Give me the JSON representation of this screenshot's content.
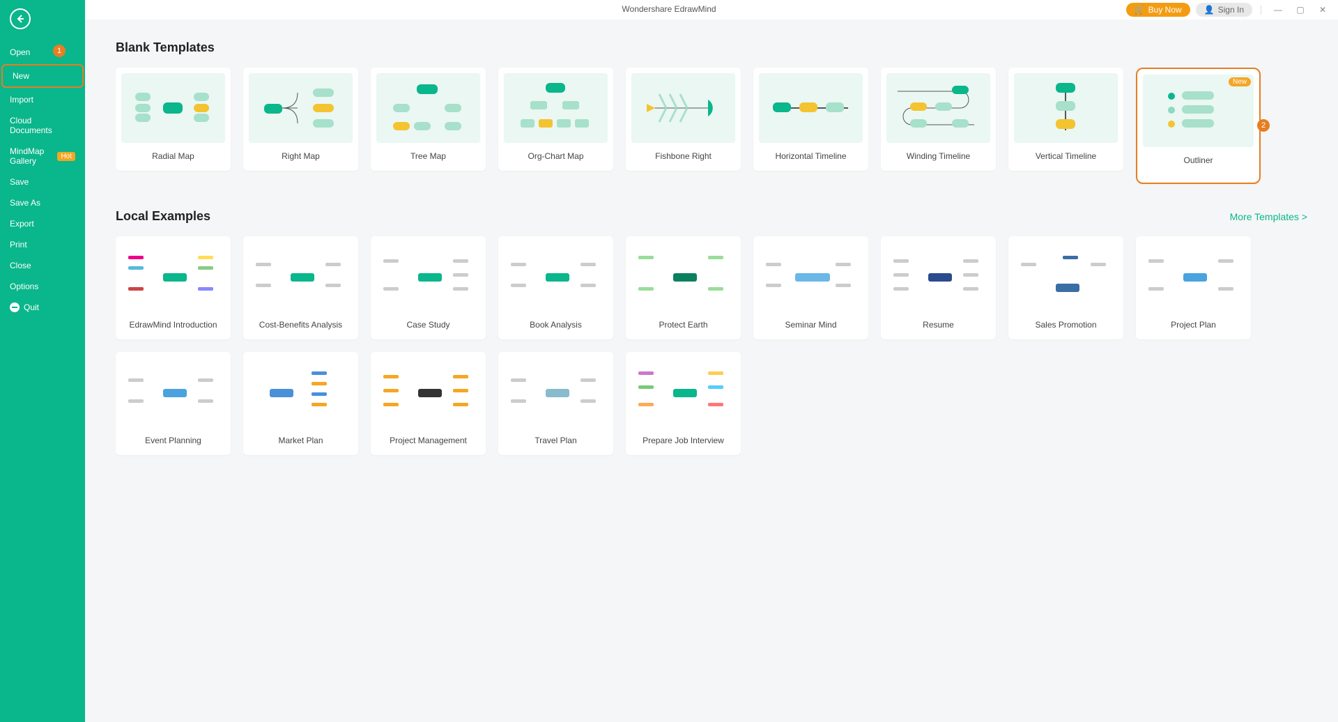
{
  "titlebar": {
    "app_title": "Wondershare EdrawMind",
    "buy_now_label": "Buy Now",
    "sign_in_label": "Sign In"
  },
  "sidebar": {
    "items": [
      {
        "label": "Open"
      },
      {
        "label": "New",
        "selected": true
      },
      {
        "label": "Import"
      },
      {
        "label": "Cloud Documents"
      },
      {
        "label": "MindMap Gallery",
        "hot": true
      },
      {
        "label": "Save"
      },
      {
        "label": "Save As"
      },
      {
        "label": "Export"
      },
      {
        "label": "Print"
      },
      {
        "label": "Close"
      },
      {
        "label": "Options"
      },
      {
        "label": "Quit",
        "quit_icon": true
      }
    ]
  },
  "step_markers": {
    "one": "1",
    "two": "2"
  },
  "sections": {
    "blank_templates_title": "Blank Templates",
    "local_examples_title": "Local Examples",
    "more_templates_label": "More Templates >"
  },
  "blank_templates": [
    {
      "label": "Radial Map"
    },
    {
      "label": "Right Map"
    },
    {
      "label": "Tree Map"
    },
    {
      "label": "Org-Chart Map"
    },
    {
      "label": "Fishbone Right"
    },
    {
      "label": "Horizontal Timeline"
    },
    {
      "label": "Winding Timeline"
    },
    {
      "label": "Vertical Timeline"
    },
    {
      "label": "Outliner",
      "new": true,
      "selected": true
    }
  ],
  "new_badge_label": "New",
  "hot_badge_label": "Hot",
  "local_examples": [
    {
      "label": "EdrawMind Introduction"
    },
    {
      "label": "Cost-Benefits Analysis"
    },
    {
      "label": "Case Study"
    },
    {
      "label": "Book Analysis"
    },
    {
      "label": "Protect Earth"
    },
    {
      "label": "Seminar Mind"
    },
    {
      "label": "Resume"
    },
    {
      "label": "Sales Promotion"
    },
    {
      "label": "Project Plan"
    },
    {
      "label": "Event Planning"
    },
    {
      "label": "Market Plan"
    },
    {
      "label": "Project Management"
    },
    {
      "label": "Travel Plan"
    },
    {
      "label": "Prepare Job Interview"
    }
  ]
}
